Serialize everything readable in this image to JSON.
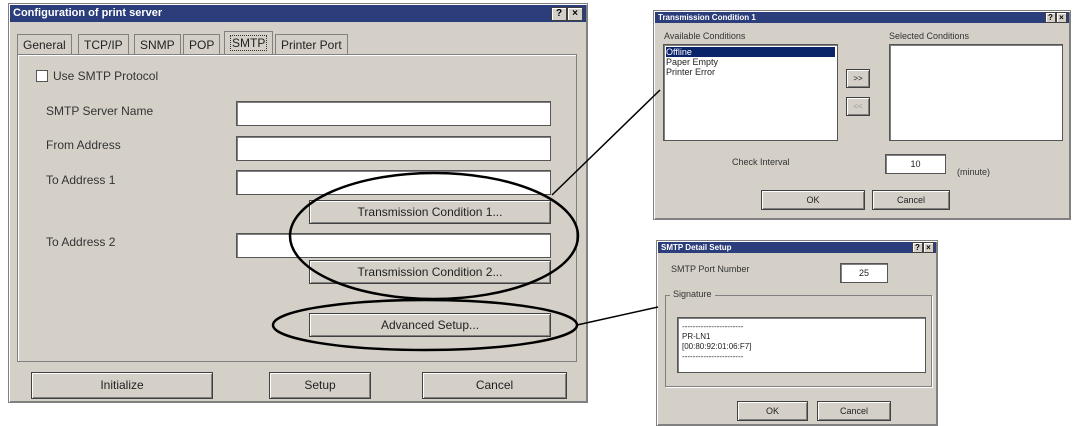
{
  "main_dialog": {
    "title": "Configuration of print server",
    "help_label": "?",
    "close_label": "×",
    "tabs": [
      {
        "label": "General"
      },
      {
        "label": "TCP/IP"
      },
      {
        "label": "SNMP"
      },
      {
        "label": "POP"
      },
      {
        "label": "SMTP"
      },
      {
        "label": "Printer Port"
      }
    ],
    "use_smtp_label": "Use SMTP Protocol",
    "smtp_server_label": "SMTP Server Name",
    "from_address_label": "From Address",
    "to_address1_label": "To Address 1",
    "to_address2_label": "To Address 2",
    "smtp_server_value": "",
    "from_address_value": "",
    "to_address1_value": "",
    "to_address2_value": "",
    "transmission1_label": "Transmission Condition 1...",
    "transmission2_label": "Transmission Condition 2...",
    "advanced_label": "Advanced Setup...",
    "initialize_label": "Initialize",
    "setup_label": "Setup",
    "cancel_label": "Cancel"
  },
  "transmission_dialog": {
    "title": "Transmission Condition 1",
    "available_header": "Available Conditions",
    "selected_header": "Selected Conditions",
    "available_items": [
      {
        "label": "Offline"
      },
      {
        "label": "Paper Empty"
      },
      {
        "label": "Printer Error"
      }
    ],
    "add_label": ">>",
    "remove_label": "<<",
    "check_interval_label": "Check Interval",
    "check_interval_value": "10",
    "unit_label": "(minute)",
    "ok_label": "OK",
    "cancel_label": "Cancel"
  },
  "smtp_detail_dialog": {
    "title": "SMTP Detail Setup",
    "port_label": "SMTP Port Number",
    "port_value": "25",
    "signature_label": "Signature",
    "signature_lines": [
      {
        "text": "-----------------------"
      },
      {
        "text": "PR-LN1"
      },
      {
        "text": "[00:80:92:01:06:F7]"
      },
      {
        "text": "-----------------------"
      }
    ],
    "ok_label": "OK",
    "cancel_label": "Cancel"
  }
}
